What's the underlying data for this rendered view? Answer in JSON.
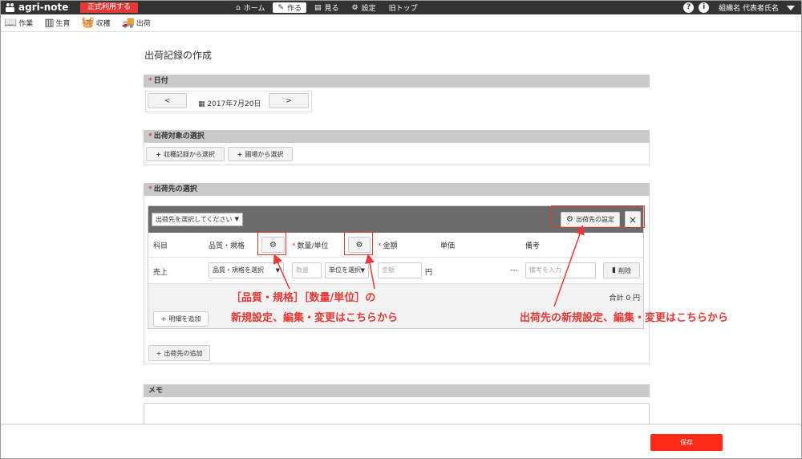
{
  "app": {
    "logo": "agri-note",
    "official_button": "正式利用する"
  },
  "nav": [
    {
      "label": "ホーム",
      "icon": "home-icon",
      "glyph": "⌂"
    },
    {
      "label": "作る",
      "icon": "pencil-icon",
      "glyph": "✎"
    },
    {
      "label": "見る",
      "icon": "document-icon",
      "glyph": "▤"
    },
    {
      "label": "設定",
      "icon": "gear-icon",
      "glyph": "⚙"
    },
    {
      "label": "旧トップ",
      "icon": "",
      "glyph": ""
    }
  ],
  "user": {
    "help": "?",
    "info": "i",
    "name": "組織名 代表者氏名"
  },
  "subnav": [
    {
      "label": "作業",
      "glyph": "📖"
    },
    {
      "label": "生育",
      "glyph": "▥"
    },
    {
      "label": "収穫",
      "glyph": "🧺"
    },
    {
      "label": "出荷",
      "glyph": "🚚"
    }
  ],
  "page": {
    "title": "出荷記録の作成"
  },
  "date_section": {
    "required_mark": "*",
    "title": "日付",
    "prev": "<",
    "next": ">",
    "date": "2017年7月20日"
  },
  "target_section": {
    "required_mark": "*",
    "title": "出荷対象の選択",
    "btn_harvest": "収穫記録から選択",
    "btn_field": "圃場から選択"
  },
  "dest_section": {
    "required_mark": "*",
    "title": "出荷先の選択",
    "select_placeholder": "出荷先を選択してください",
    "settings_button": "出荷先の設定",
    "close": "×",
    "columns": {
      "subject": "科目",
      "quality": "品質・規格",
      "qty_req": "*",
      "qty": "数量/単位",
      "amount_req": "*",
      "amount": "金額",
      "unit_price": "単価",
      "note": "備考"
    },
    "row": {
      "subject": "売上",
      "quality_select": "品質・規格を選択",
      "qty_placeholder": "数量",
      "unit_select": "単位を選択",
      "amount_placeholder": "金額",
      "yen": "円",
      "unit_price": "---",
      "note_placeholder": "備考を入力",
      "delete": "削除"
    },
    "total": "合計 0 円",
    "add_detail": "明細を追加",
    "add_dest": "出荷先の追加"
  },
  "memo_section": {
    "title": "メモ"
  },
  "annotations": {
    "left_line1": "［品質・規格］［数量/単位］の",
    "left_line2": "新規設定、編集・変更はこちらから",
    "right": "出荷先の新規設定、編集・変更はこちらから"
  },
  "footer": {
    "save": "保存"
  },
  "colors": {
    "accent_red": "#e53935",
    "save_red": "#ff2a1a",
    "topbar": "#333333",
    "section_gray": "#c9c9c9"
  }
}
